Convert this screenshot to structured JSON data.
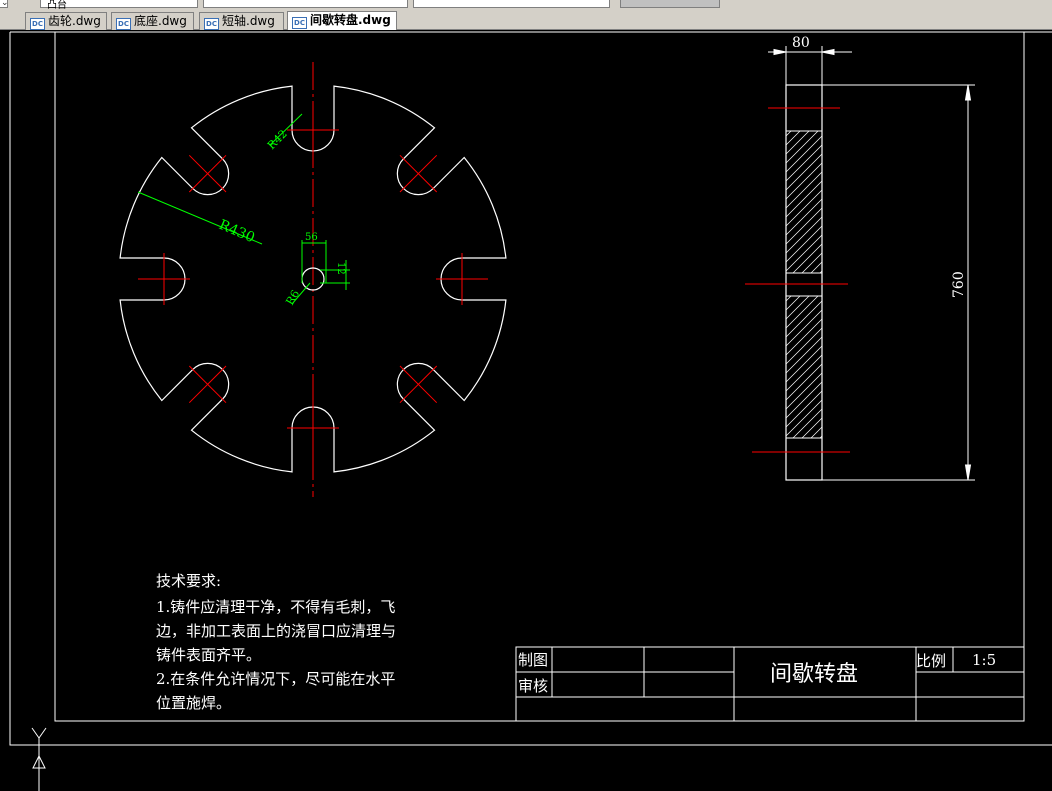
{
  "tabs": [
    {
      "label": "齿轮.dwg",
      "active": false
    },
    {
      "label": "底座.dwg",
      "active": false
    },
    {
      "label": "短轴.dwg",
      "active": false
    },
    {
      "label": "间歇转盘.dwg",
      "active": true
    }
  ],
  "toolbar": {
    "layer_value": "凸台"
  },
  "drawing": {
    "dims": {
      "width": "80",
      "height": "760",
      "r42": "R42",
      "r430": "R430",
      "d56": "56",
      "d12": "12",
      "r6": "R6"
    },
    "notes": {
      "title": "技术要求:",
      "line1": "1.铸件应清理干净，不得有毛刺，飞",
      "line2": "边，非加工表面上的浇冒口应清理与",
      "line3": "铸件表面齐平。",
      "line4": "2.在条件允许情况下，尽可能在水平",
      "line5": "位置施焊。"
    },
    "title_block": {
      "drawn": "制图",
      "checked": "审核",
      "part": "间歇转盘",
      "scale_label": "比例",
      "scale": "1:5"
    }
  },
  "colors": {
    "line": "#ffffff",
    "center": "#ff0000",
    "dim": "#00ff00",
    "hatch": "#ffffff"
  }
}
